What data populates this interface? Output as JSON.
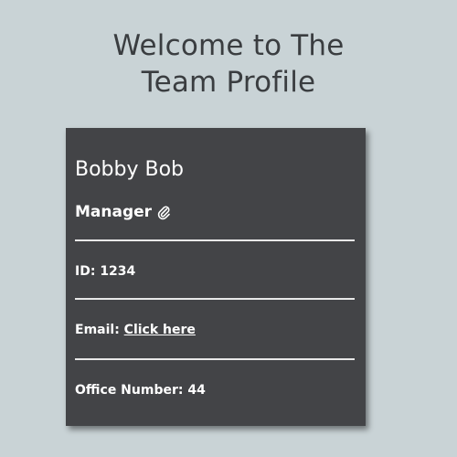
{
  "header": {
    "title_line1": "Welcome to The",
    "title_line2": "Team Profile"
  },
  "card": {
    "name": "Bobby Bob",
    "role": "Manager",
    "role_icon": "paperclip-icon",
    "id_label": "ID:",
    "id_value": "1234",
    "email_label": "Email:",
    "email_link_text": "Click here",
    "office_label": "Office Number:",
    "office_value": "44"
  },
  "colors": {
    "background": "#c9d3d6",
    "card_background": "#434447",
    "title_text": "#3a3d40",
    "card_text": "#ffffff"
  }
}
